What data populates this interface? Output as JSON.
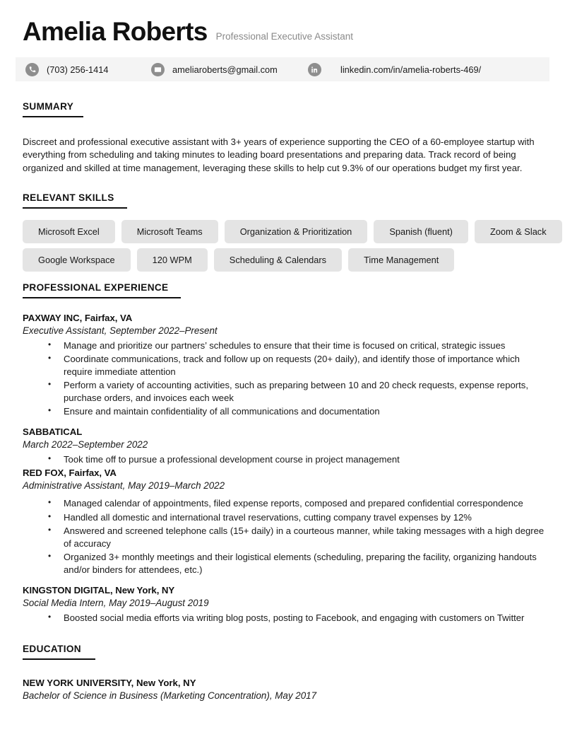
{
  "header": {
    "name": "Amelia Roberts",
    "subtitle": "Professional Executive Assistant"
  },
  "contact": {
    "phone": {
      "icon": "phone-icon",
      "value": "(703) 256-1414"
    },
    "email": {
      "icon": "envelope-icon",
      "value": "ameliaroberts@gmail.com"
    },
    "linkedin": {
      "icon": "linkedin-icon",
      "value": "linkedin.com/in/amelia-roberts-469/"
    }
  },
  "summary": {
    "heading": "SUMMARY",
    "text": "Discreet and professional executive assistant with 3+ years of experience supporting the CEO of a 60-employee startup with everything from scheduling and taking minutes to leading board presentations and preparing data. Track record of being organized and skilled at time management, leveraging these skills to help cut 9.3% of our operations budget my first year."
  },
  "skills": {
    "heading": "RELEVANT SKILLS",
    "rows": [
      [
        "Microsoft Excel",
        "Microsoft Teams",
        "Organization & Prioritization",
        "Spanish (fluent)",
        "Zoom & Slack"
      ],
      [
        "Google Workspace",
        "120 WPM",
        "Scheduling & Calendars",
        "Time Management"
      ]
    ]
  },
  "experience": {
    "heading": "PROFESSIONAL EXPERIENCE",
    "jobs": [
      {
        "company": "PAXWAY INC, Fairfax, VA",
        "role": "Executive Assistant, September 2022–Present",
        "bullets": [
          "Manage and prioritize our partners’ schedules to ensure that their time is focused on critical, strategic issues",
          "Coordinate communications, track and follow up on requests (20+ daily), and identify those of importance which require immediate attention",
          "Perform a variety of accounting activities, such as preparing between 10 and 20 check requests, expense reports, purchase orders, and invoices each week",
          "Ensure and maintain confidentiality of all communications and documentation"
        ]
      },
      {
        "company": "SABBATICAL",
        "role": "March 2022–September 2022",
        "bullets": [
          "Took time off to pursue a professional development course in project management"
        ]
      },
      {
        "company": "RED FOX, Fairfax, VA",
        "role": "Administrative Assistant, May 2019–March 2022",
        "bullets": [
          "Managed calendar of appointments, filed expense reports, composed and prepared confidential correspondence",
          "Handled all domestic and international travel reservations, cutting company travel expenses by 12%",
          "Answered and screened telephone calls (15+ daily) in a courteous manner, while taking messages with a high degree of accuracy",
          "Organized 3+ monthly meetings and their logistical elements (scheduling, preparing the facility, organizing handouts and/or binders for attendees, etc.)"
        ]
      },
      {
        "company": "KINGSTON DIGITAL, New York, NY",
        "role": "Social Media Intern, May 2019–August 2019",
        "bullets": [
          "Boosted social media efforts via writing blog posts, posting to Facebook, and engaging with customers on Twitter"
        ]
      }
    ]
  },
  "education": {
    "heading": "EDUCATION",
    "school": "NEW YORK UNIVERSITY, New York, NY",
    "degree": "Bachelor of Science in Business (Marketing Concentration), May 2017"
  },
  "colors": {
    "text": "#1a1a1a",
    "heading": "#111111",
    "subtitle": "#8a8a8a",
    "contact_bar_bg": "#f4f4f4",
    "chip_bg": "#e4e4e4",
    "icon_bg": "#8e8e8e"
  }
}
